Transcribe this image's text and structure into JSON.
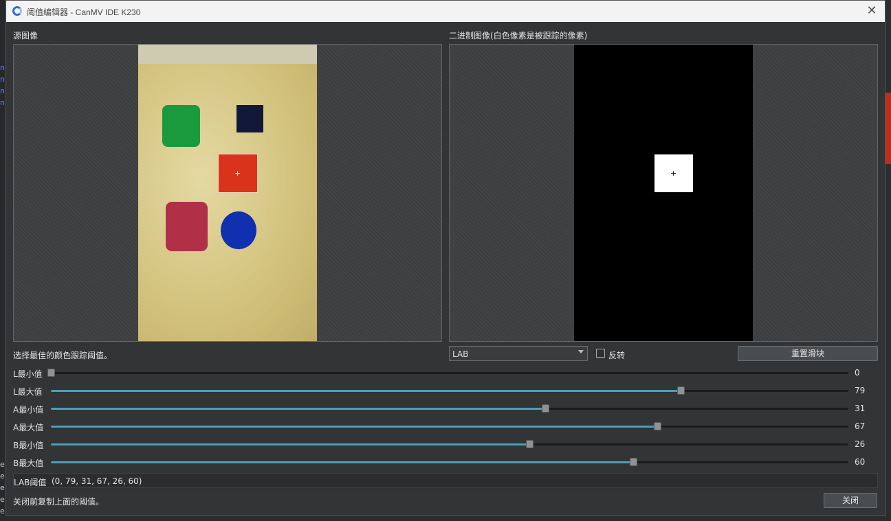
{
  "window": {
    "title": "阈值编辑器 - CanMV IDE K230"
  },
  "source_panel": {
    "label": "源图像"
  },
  "binary_panel": {
    "label": "二进制图像(白色像素是被跟踪的像素)"
  },
  "hint_text": "选择最佳的颜色跟踪阈值。",
  "colorspace_select": {
    "selected": "LAB"
  },
  "invert_checkbox": {
    "label": "反转",
    "checked": false
  },
  "reset_button": {
    "label": "重置滑块"
  },
  "sliders": [
    {
      "label": "L最小值",
      "value": "0",
      "fraction": 0.0
    },
    {
      "label": "L最大值",
      "value": "79",
      "fraction": 0.79
    },
    {
      "label": "A最小值",
      "value": "31",
      "fraction": 0.62
    },
    {
      "label": "A最大值",
      "value": "67",
      "fraction": 0.76
    },
    {
      "label": "B最小值",
      "value": "26",
      "fraction": 0.6
    },
    {
      "label": "B最大值",
      "value": "60",
      "fraction": 0.73
    }
  ],
  "threshold": {
    "label": "LAB阈值",
    "value": "(0, 79, 31, 67, 26, 60)"
  },
  "footer": {
    "note": "关闭前复制上面的阈值。",
    "close_label": "关闭"
  },
  "colors": {
    "accent": "#4c9fb8",
    "dialog_bg": "#323436",
    "green_square": "#1a9a3c",
    "navy_square": "#121838",
    "red_square": "#d9331c",
    "maroon_square": "#b03048",
    "blue_circle": "#1030b0"
  }
}
